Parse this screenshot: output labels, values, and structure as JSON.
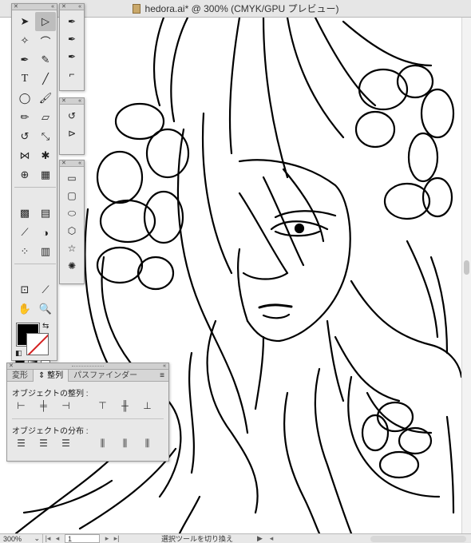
{
  "window": {
    "title": "hedora.ai* @ 300% (CMYK/GPU プレビュー)"
  },
  "status": {
    "zoom": "300%",
    "page": "1",
    "text": "選択ツールを切り換え"
  },
  "align_panel": {
    "tabs": [
      "変形",
      "整列",
      "パスファインダー"
    ],
    "align_label": "オブジェクトの整列 :",
    "distribute_label": "オブジェクトの分布 :"
  },
  "colors": {
    "fill": "#000000",
    "stroke_none": "#d42020",
    "panel_bg": "#e8e8e8"
  },
  "icons": {
    "tools": [
      "selection",
      "direct-selection",
      "magic-wand",
      "lasso",
      "pen",
      "curvature",
      "type",
      "line",
      "ellipse",
      "paintbrush",
      "pencil",
      "eraser",
      "rotate",
      "scale",
      "width",
      "puppet-warp",
      "shape-builder",
      "perspective",
      "mesh",
      "gradient",
      "eyedropper",
      "blend",
      "symbol-sprayer",
      "graph",
      "artboard",
      "slice",
      "hand",
      "zoom"
    ]
  }
}
